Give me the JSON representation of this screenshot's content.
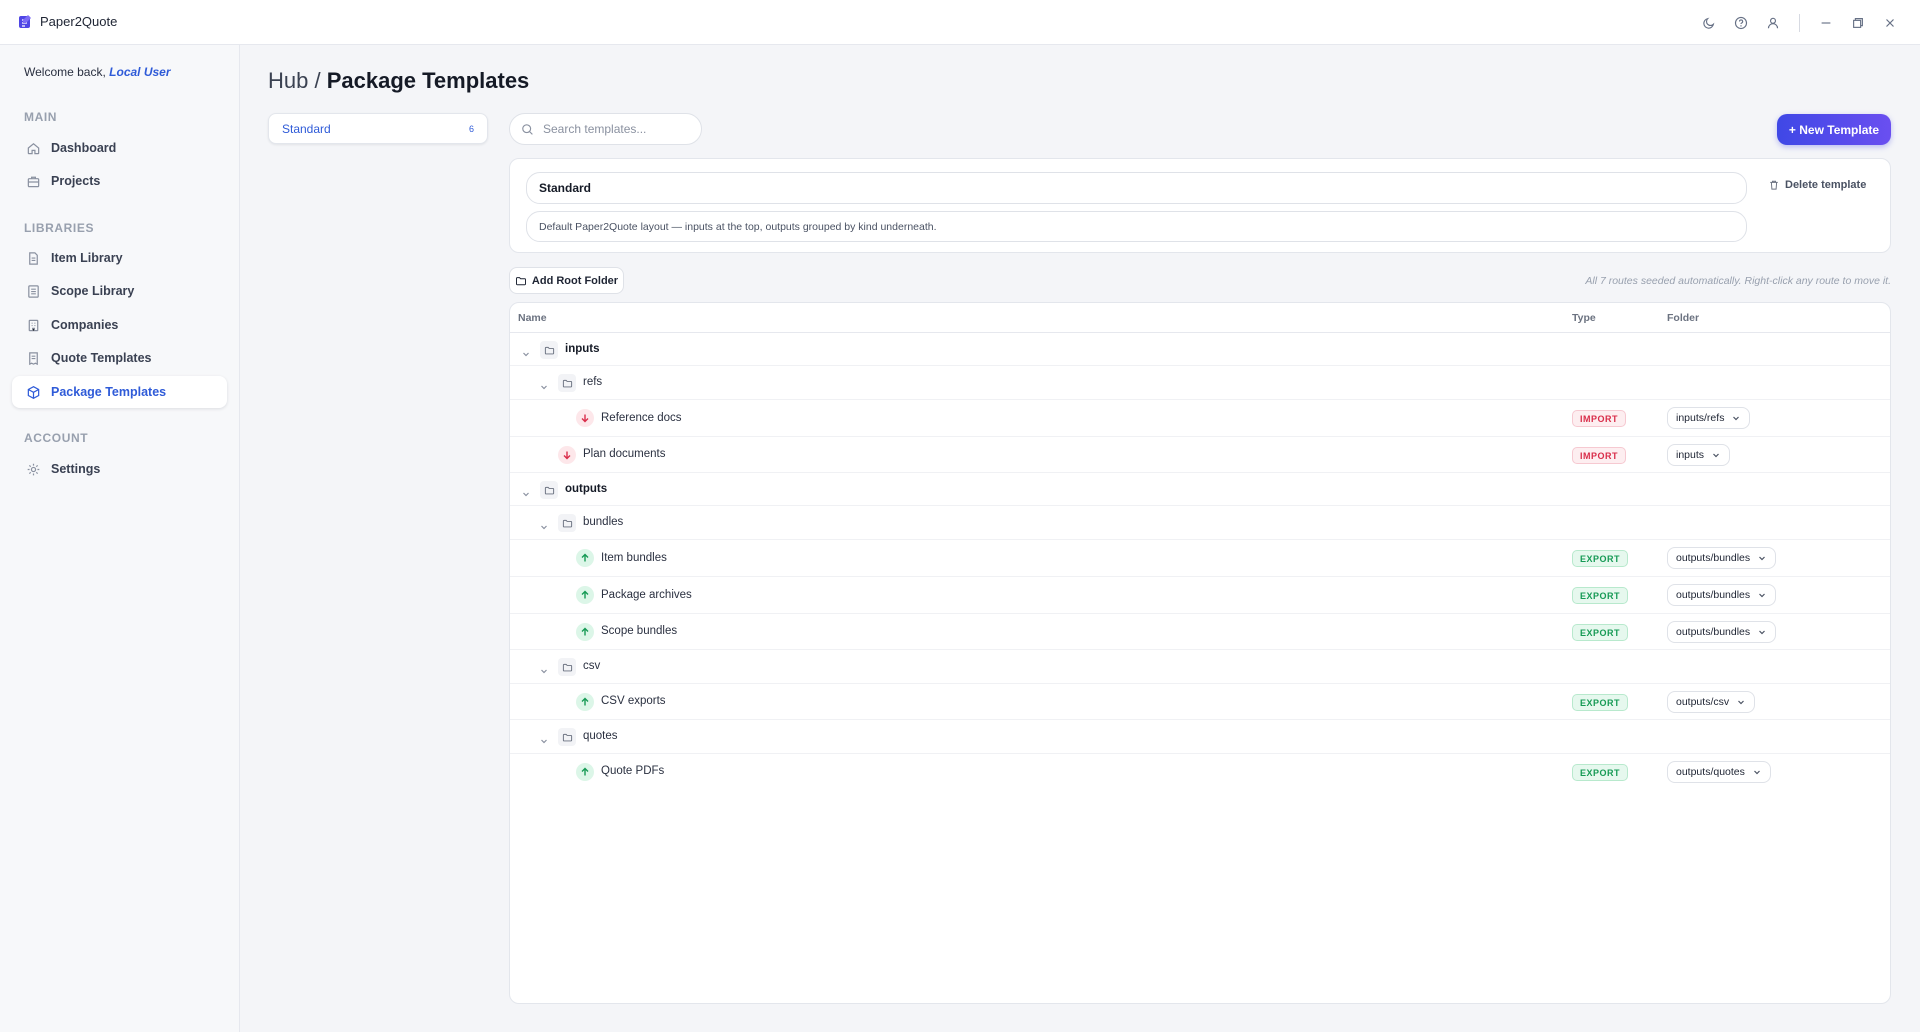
{
  "app": {
    "name": "Paper2Quote"
  },
  "sidebar": {
    "welcome_prefix": "Welcome back,",
    "user": "Local User",
    "sections": {
      "main": "MAIN",
      "libraries": "LIBRARIES",
      "account": "ACCOUNT"
    },
    "items": {
      "dashboard": {
        "label": "Dashboard",
        "icon": "home-icon"
      },
      "projects": {
        "label": "Projects",
        "icon": "briefcase-icon"
      },
      "item_library": {
        "label": "Item Library",
        "icon": "document-icon"
      },
      "scope_library": {
        "label": "Scope Library",
        "icon": "list-icon"
      },
      "companies": {
        "label": "Companies",
        "icon": "building-icon"
      },
      "quote_templates": {
        "label": "Quote Templates",
        "icon": "receipt-icon"
      },
      "package_templates": {
        "label": "Package Templates",
        "icon": "package-icon",
        "active": true
      },
      "settings": {
        "label": "Settings",
        "icon": "gear-icon"
      }
    }
  },
  "main": {
    "breadcrumb": {
      "root": "Hub",
      "separator": " / ",
      "current": "Package Templates"
    },
    "template_list": [
      {
        "name": "Standard",
        "count": "6"
      }
    ],
    "search": {
      "placeholder": "Search templates...",
      "value": ""
    },
    "new_template_label": "+ New Template",
    "editor": {
      "name": "Standard",
      "description": "Default Paper2Quote layout — inputs at the top, outputs grouped by kind underneath.",
      "delete_label": "Delete template"
    },
    "add_root_folder_label": "Add Root Folder",
    "hint": "All 7 routes seeded automatically. Right-click any route to move it.",
    "table": {
      "headers": {
        "name": "Name",
        "type": "Type",
        "folder": "Folder"
      },
      "rows": [
        {
          "kind": "folder",
          "name": "inputs"
        },
        {
          "kind": "folder",
          "name": "refs"
        },
        {
          "kind": "route",
          "name": "Reference docs",
          "type": "IMPORT",
          "folder": "inputs/refs"
        },
        {
          "kind": "route",
          "name": "Plan documents",
          "type": "IMPORT",
          "folder": "inputs"
        },
        {
          "kind": "folder",
          "name": "outputs"
        },
        {
          "kind": "folder",
          "name": "bundles"
        },
        {
          "kind": "route",
          "name": "Item bundles",
          "type": "EXPORT",
          "folder": "outputs/bundles"
        },
        {
          "kind": "route",
          "name": "Package archives",
          "type": "EXPORT",
          "folder": "outputs/bundles"
        },
        {
          "kind": "route",
          "name": "Scope bundles",
          "type": "EXPORT",
          "folder": "outputs/bundles"
        },
        {
          "kind": "folder",
          "name": "csv"
        },
        {
          "kind": "route",
          "name": "CSV exports",
          "type": "EXPORT",
          "folder": "outputs/csv"
        },
        {
          "kind": "folder",
          "name": "quotes"
        },
        {
          "kind": "route",
          "name": "Quote PDFs",
          "type": "EXPORT",
          "folder": "outputs/quotes"
        }
      ]
    }
  },
  "colors": {
    "accent": "#2f5bd8",
    "button_gradient_start": "#3f48e6",
    "button_gradient_end": "#6a4ff0",
    "import": "#d92d4a",
    "export": "#169a55"
  }
}
